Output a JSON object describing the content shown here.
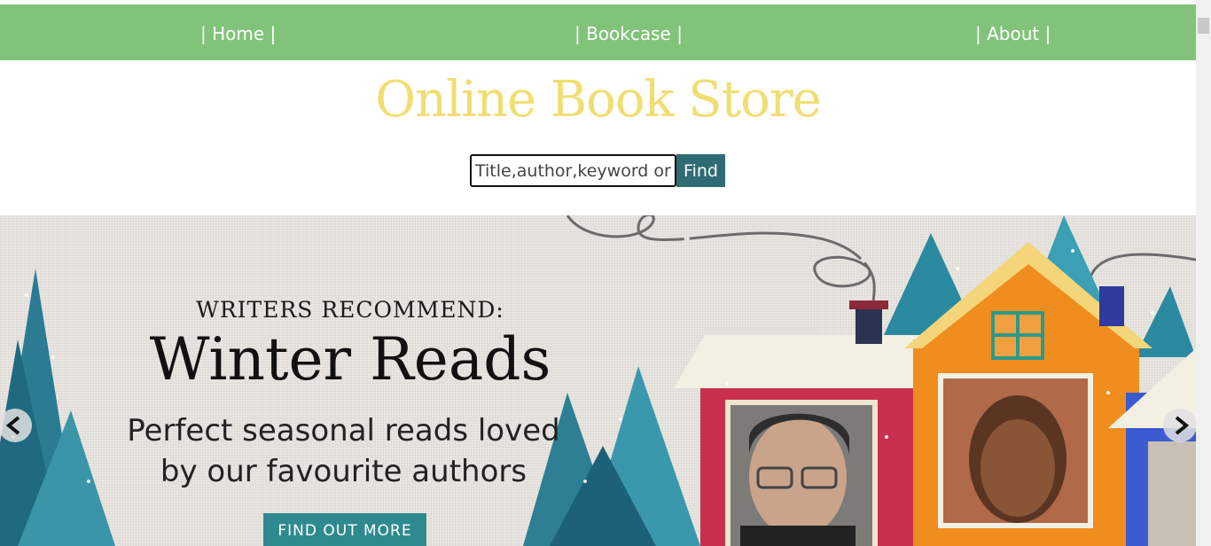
{
  "nav": {
    "home": "| Home |",
    "bookcase": "| Bookcase |",
    "about": "| About |"
  },
  "header": {
    "title": "Online Book Store"
  },
  "search": {
    "placeholder": "Title,author,keyword or ISBN",
    "button_label": "Find"
  },
  "banner": {
    "overline": "WRITERS RECOMMEND:",
    "headline": "Winter Reads",
    "subtitle_line1": "Perfect seasonal reads loved",
    "subtitle_line2": "by our favourite authors",
    "cta_label": "FIND OUT MORE",
    "prev_icon": "chevron-left-icon",
    "next_icon": "chevron-right-icon"
  },
  "colors": {
    "nav_bg": "#82c37a",
    "title": "#f0de73",
    "button": "#2f6b72",
    "cta": "#2f8a8f"
  }
}
